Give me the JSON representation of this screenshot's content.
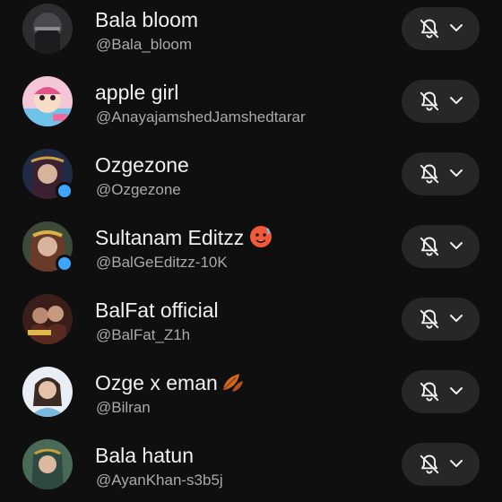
{
  "colors": {
    "background": "#0f0f0f",
    "button_bg": "#272727",
    "primary_text": "#f1f1f1",
    "secondary_text": "#aaaaaa",
    "live_indicator": "#3ea6ff"
  },
  "subscriptions": [
    {
      "name": "Bala bloom",
      "handle": "@Bala_bloom",
      "notification_icon": "bell-off-icon",
      "dropdown_icon": "chevron-down-icon",
      "new_content_dot": false
    },
    {
      "name": "apple girl",
      "handle": "@AnayajamshedJamshedtarar",
      "notification_icon": "bell-off-icon",
      "dropdown_icon": "chevron-down-icon",
      "new_content_dot": false
    },
    {
      "name": "Ozgezone",
      "handle": "@Ozgezone",
      "notification_icon": "bell-off-icon",
      "dropdown_icon": "chevron-down-icon",
      "new_content_dot": true
    },
    {
      "name": "Sultanam Editzz",
      "emoji": "hot-face-emoji",
      "handle": "@BalGeEditzz-10K",
      "notification_icon": "bell-off-icon",
      "dropdown_icon": "chevron-down-icon",
      "new_content_dot": true
    },
    {
      "name": "BalFat official",
      "handle": "@BalFat_Z1h",
      "notification_icon": "bell-off-icon",
      "dropdown_icon": "chevron-down-icon",
      "new_content_dot": false
    },
    {
      "name": "Ozge x eman",
      "emoji": "fallen-leaf-emoji",
      "handle": "@Bilran",
      "notification_icon": "bell-off-icon",
      "dropdown_icon": "chevron-down-icon",
      "new_content_dot": false
    },
    {
      "name": "Bala hatun",
      "handle": "@AyanKhan-s3b5j",
      "notification_icon": "bell-off-icon",
      "dropdown_icon": "chevron-down-icon",
      "new_content_dot": false
    }
  ]
}
